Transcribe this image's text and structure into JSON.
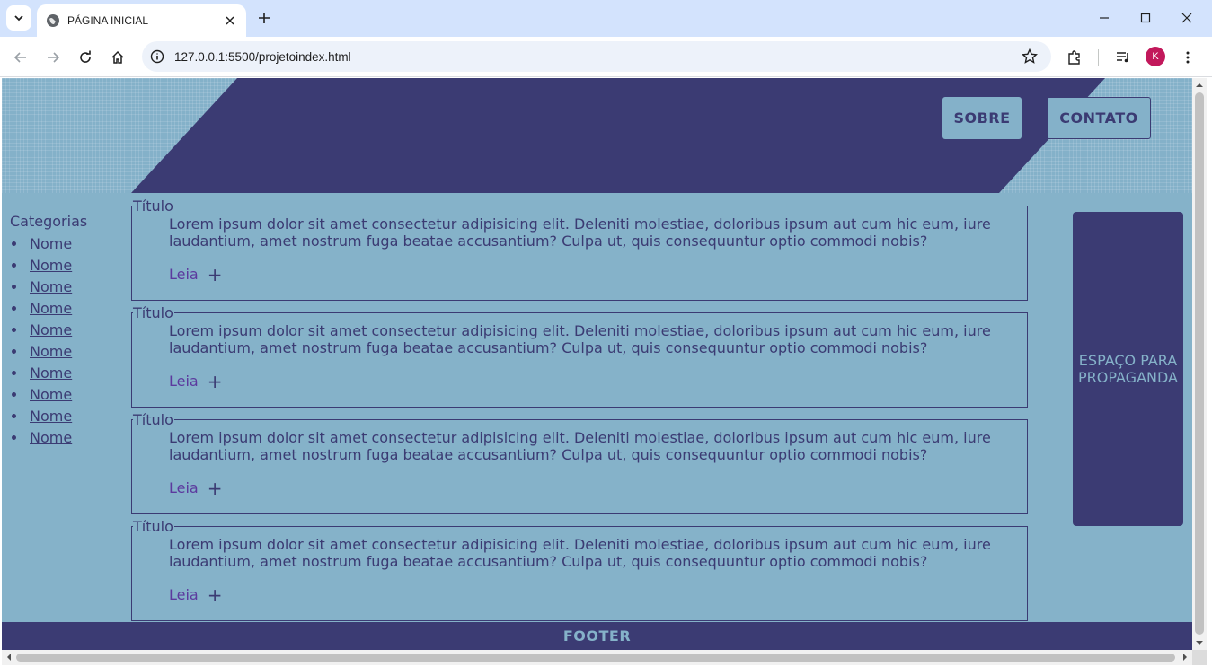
{
  "browser": {
    "tab_title": "PÁGINA INICIAL",
    "url": "127.0.0.1:5500/projetoindex.html",
    "profile_initial": "K"
  },
  "header": {
    "nav": [
      {
        "label": "SOBRE"
      },
      {
        "label": "CONTATO"
      }
    ]
  },
  "sidebar": {
    "title": "Categorias",
    "items": [
      "Nome",
      "Nome",
      "Nome",
      "Nome",
      "Nome",
      "Nome",
      "Nome",
      "Nome",
      "Nome",
      "Nome"
    ]
  },
  "articles": [
    {
      "title": "Título",
      "text": "Lorem ipsum dolor sit amet consectetur adipisicing elit. Deleniti molestiae, doloribus ipsum aut cum hic eum, iure laudantium, amet nostrum fuga beatae accusantium? Culpa ut, quis consequuntur optio commodi nobis?",
      "more": "Leia",
      "plus": "+"
    },
    {
      "title": "Título",
      "text": "Lorem ipsum dolor sit amet consectetur adipisicing elit. Deleniti molestiae, doloribus ipsum aut cum hic eum, iure laudantium, amet nostrum fuga beatae accusantium? Culpa ut, quis consequuntur optio commodi nobis?",
      "more": "Leia",
      "plus": "+"
    },
    {
      "title": "Título",
      "text": "Lorem ipsum dolor sit amet consectetur adipisicing elit. Deleniti molestiae, doloribus ipsum aut cum hic eum, iure laudantium, amet nostrum fuga beatae accusantium? Culpa ut, quis consequuntur optio commodi nobis?",
      "more": "Leia",
      "plus": "+"
    },
    {
      "title": "Título",
      "text": "Lorem ipsum dolor sit amet consectetur adipisicing elit. Deleniti molestiae, doloribus ipsum aut cum hic eum, iure laudantium, amet nostrum fuga beatae accusantium? Culpa ut, quis consequuntur optio commodi nobis?",
      "more": "Leia",
      "plus": "+"
    }
  ],
  "ad": {
    "text": "ESPAÇO PARA PROPAGANDA"
  },
  "footer": {
    "text": "FOOTER"
  },
  "colors": {
    "background": "#85b2c9",
    "primary": "#3b3b73",
    "link_visited": "#5c3a9e",
    "browser_tabbar": "#d3e3fd",
    "avatar": "#c2185b"
  }
}
